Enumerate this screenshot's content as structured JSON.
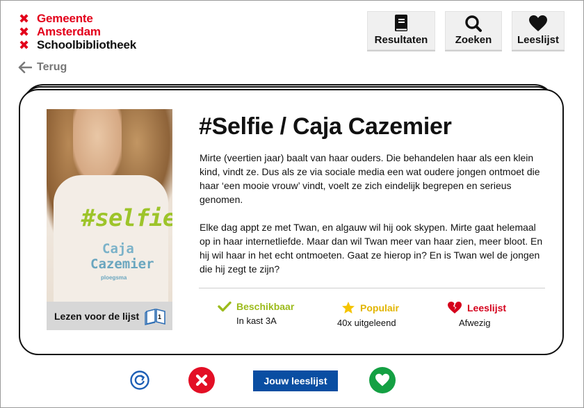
{
  "logo": {
    "lines": [
      "Gemeente",
      "Amsterdam",
      "Schoolbibliotheek"
    ]
  },
  "nav": {
    "back_label": "Terug",
    "results_label": "Resultaten",
    "search_label": "Zoeken",
    "readinglist_label": "Leeslijst"
  },
  "book": {
    "title": "#Selfie / Caja Cazemier",
    "cover": {
      "title": "#selfie",
      "author_first": "Caja",
      "author_last": "Cazemier",
      "publisher": "ploegsma",
      "band_label": "Lezen voor de lijst",
      "band_badge": "1"
    },
    "description": [
      "Mirte (veertien jaar) baalt van haar ouders. Die behandelen haar als een klein kind, vindt ze. Dus als ze via sociale media een wat oudere jongen ontmoet die haar ‘een mooie vrouw’ vindt, voelt ze zich eindelijk begrepen en serieus genomen.",
      "Elke dag appt ze met Twan, en algauw wil hij ook skypen. Mirte gaat helemaal op in haar internetliefde. Maar dan wil Twan meer van haar zien, meer bloot. En hij wil haar in het echt ontmoeten. Gaat ze hierop in? En is Twan wel de jongen die hij zegt te zijn?"
    ],
    "stats": {
      "availability_label": "Beschikbaar",
      "availability_value": "In kast 3A",
      "popularity_label": "Populair",
      "popularity_value": "40x uitgeleend",
      "readinglist_label": "Leeslijst",
      "readinglist_value": "Afwezig"
    }
  },
  "actions": {
    "my_list_label": "Jouw leeslijst"
  },
  "colors": {
    "brand_red": "#e3001b",
    "available_green": "#9cbb1c",
    "popular_yellow": "#e2b500",
    "list_red": "#d5001c",
    "primary_blue": "#0a4ea2",
    "like_green": "#14a043"
  },
  "icons": {
    "results": "book-icon",
    "search": "magnifier-icon",
    "readinglist": "heart-icon",
    "back": "arrow-left-icon",
    "refresh": "refresh-icon",
    "reject": "close-icon",
    "like": "heart-icon"
  }
}
